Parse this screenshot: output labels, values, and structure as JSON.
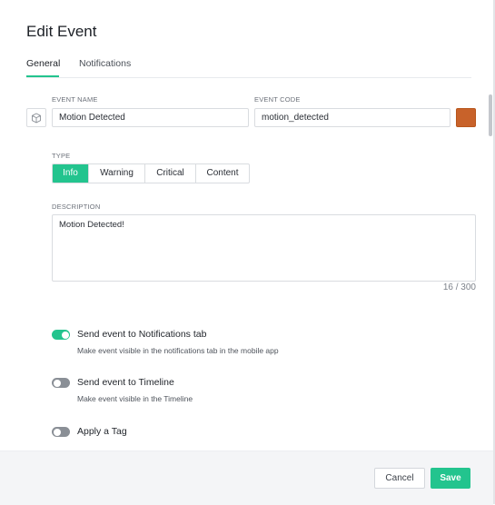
{
  "dialog": {
    "title": "Edit Event"
  },
  "tabs": [
    {
      "label": "General",
      "active": true
    },
    {
      "label": "Notifications",
      "active": false
    }
  ],
  "fields": {
    "event_name": {
      "label": "EVENT NAME",
      "value": "Motion Detected",
      "icon": "cube-icon"
    },
    "event_code": {
      "label": "EVENT CODE",
      "value": "motion_detected",
      "color": "#c8622a"
    }
  },
  "type": {
    "label": "TYPE",
    "options": [
      "Info",
      "Warning",
      "Critical",
      "Content"
    ],
    "selected": "Info"
  },
  "description": {
    "label": "DESCRIPTION",
    "value": "Motion Detected!",
    "counter": "16 / 300"
  },
  "options": [
    {
      "title": "Send event to Notifications tab",
      "desc": "Make event visible in the notifications tab in the mobile app",
      "enabled": true
    },
    {
      "title": "Send event to Timeline",
      "desc": "Make event visible in the Timeline",
      "enabled": false
    },
    {
      "title": "Apply a Tag",
      "desc": "",
      "enabled": false
    }
  ],
  "footer": {
    "cancel_label": "Cancel",
    "save_label": "Save"
  },
  "colors": {
    "accent": "#23c48e",
    "toggle_off": "#8a8f96"
  }
}
